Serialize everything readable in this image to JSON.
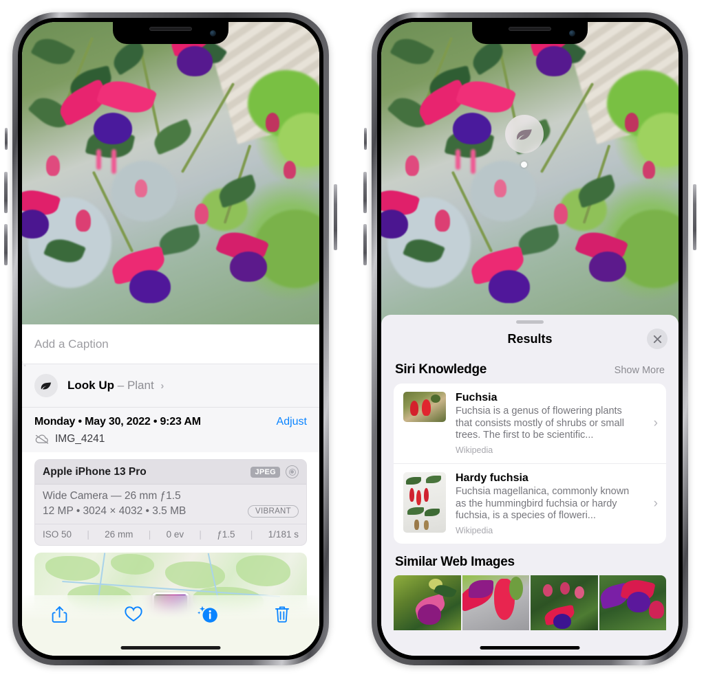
{
  "left_phone": {
    "caption_placeholder": "Add a Caption",
    "lookup": {
      "label": "Look Up",
      "dash": "–",
      "subject": "Plant",
      "chevron": "›",
      "icon": "leaf-icon",
      "sparkle_icon": "sparkle-icon"
    },
    "meta": {
      "date": "Monday • May 30, 2022 • 9:23 AM",
      "adjust": "Adjust",
      "filename": "IMG_4241",
      "cloud_icon": "cloud-slash-icon"
    },
    "camera_card": {
      "device": "Apple iPhone 13 Pro",
      "format_badge": "JPEG",
      "aperture_icon": "aperture-icon",
      "lens": "Wide Camera — 26 mm ƒ1.5",
      "specs": "12 MP • 3024 × 4032 • 3.5 MB",
      "style_pill": "VIBRANT",
      "exif": [
        "ISO 50",
        "26 mm",
        "0 ev",
        "ƒ1.5",
        "1/181 s"
      ],
      "exif_separator": "|"
    },
    "toolbar": [
      {
        "name": "share-button",
        "icon": "share-icon"
      },
      {
        "name": "favorite-button",
        "icon": "heart-icon"
      },
      {
        "name": "info-button",
        "icon": "info-sparkle-icon"
      },
      {
        "name": "delete-button",
        "icon": "trash-icon"
      }
    ]
  },
  "right_phone": {
    "visual_lookup_badge": {
      "icon": "leaf-icon"
    },
    "sheet": {
      "title": "Results",
      "close_icon": "close-icon",
      "siri_knowledge": {
        "title": "Siri Knowledge",
        "show_more": "Show More",
        "items": [
          {
            "title": "Fuchsia",
            "description": "Fuchsia is a genus of flowering plants that consists mostly of shrubs or small trees. The first to be scientific...",
            "source": "Wikipedia",
            "chevron": "›"
          },
          {
            "title": "Hardy fuchsia",
            "description": "Fuchsia magellanica, commonly known as the hummingbird fuchsia or hardy fuchsia, is a species of floweri...",
            "source": "Wikipedia",
            "chevron": "›"
          }
        ]
      },
      "similar_web_images": {
        "title": "Similar Web Images",
        "count": 4
      }
    }
  },
  "colors": {
    "accent_blue": "#0a84ff",
    "sheet_bg": "#f0eff4",
    "card_bg": "#ffffff",
    "secondary_text": "#76767c",
    "badge_gray": "#a9a9b0"
  }
}
